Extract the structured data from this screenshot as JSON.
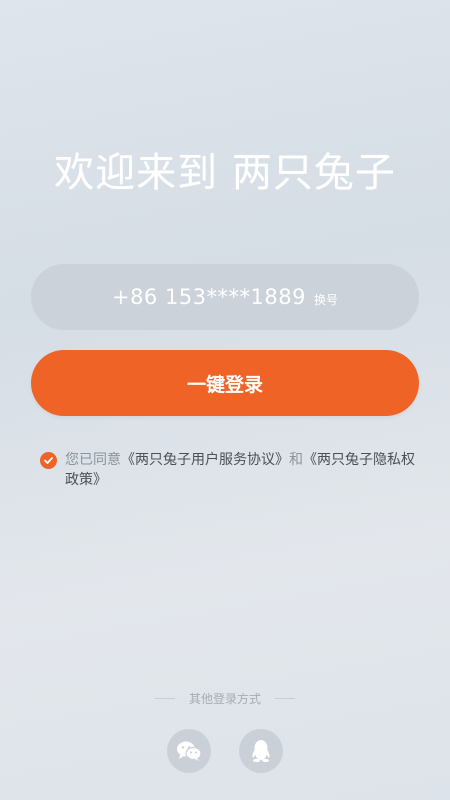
{
  "header": {
    "welcome_text": "欢迎来到 两只兔子"
  },
  "phone": {
    "number": "+86 153****1889",
    "switch_label": "换号"
  },
  "login": {
    "button_label": "一键登录"
  },
  "agreement": {
    "checked": true,
    "prefix": "您已同意",
    "user_agreement": "《两只兔子用户服务协议》",
    "conjunction": "和",
    "privacy_policy": "《两只兔子隐私权政策》"
  },
  "other_login": {
    "title": "其他登录方式",
    "methods": [
      {
        "icon": "wechat-icon"
      },
      {
        "icon": "qq-icon"
      }
    ]
  },
  "colors": {
    "accent": "#ef6327",
    "field_bg": "#cbd2d9",
    "icon_bg": "#c9d0d7"
  }
}
